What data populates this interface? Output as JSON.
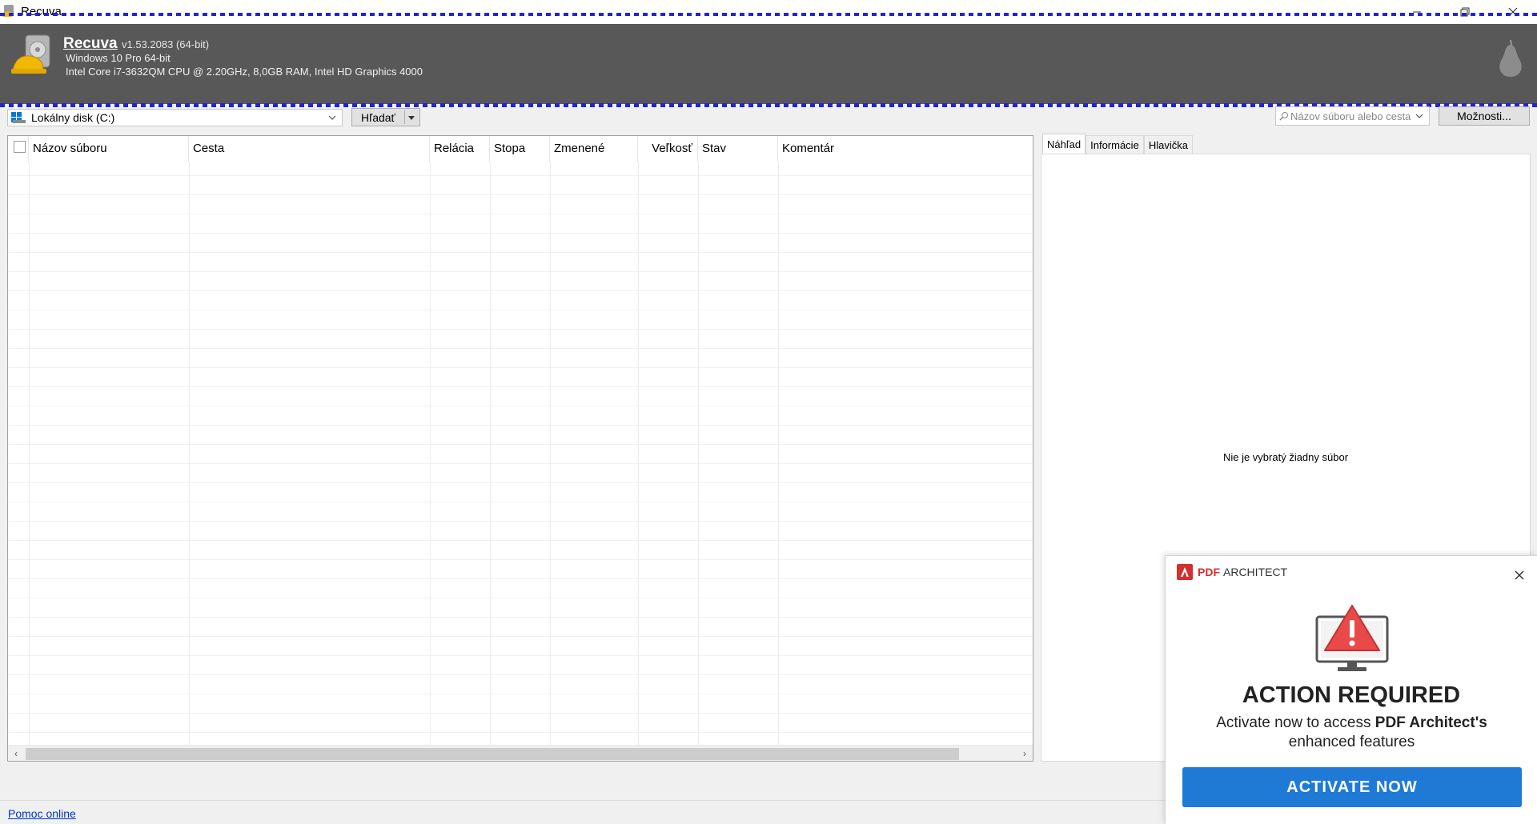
{
  "window": {
    "title": "Recuva",
    "icons": {
      "app": "recuva-app-icon",
      "minimize": "minimize-icon",
      "maximize": "restore-icon",
      "close": "close-icon"
    }
  },
  "header": {
    "app_name": "Recuva",
    "version": "v1.53.2083 (64-bit)",
    "os": "Windows 10 Pro 64-bit",
    "hardware": "Intel Core i7-3632QM CPU @ 2.20GHz, 8,0GB RAM, Intel HD Graphics 4000",
    "background_color": "#585858"
  },
  "toolbar": {
    "drive": "Lokálny disk (C:)",
    "scan_label": "Hľadať",
    "search_placeholder": "Názov súboru alebo cesta",
    "options_label": "Možnosti..."
  },
  "table": {
    "columns": [
      "Názov súboru",
      "Cesta",
      "Relácia",
      "Stopa",
      "Zmenené",
      "Veľkosť",
      "Stav",
      "Komentár"
    ],
    "rows": []
  },
  "panel": {
    "tabs": [
      "Náhľad",
      "Informácie",
      "Hlavička"
    ],
    "active_tab": "Náhľad",
    "empty_text": "Nie je vybratý žiadny súbor"
  },
  "status": {
    "help_link": "Pomoc online"
  },
  "popup": {
    "brand_pdf": "PDF",
    "brand_architect": "ARCHITECT",
    "headline": "ACTION REQUIRED",
    "sub_before": "Activate now to access ",
    "sub_bold": "PDF Architect's",
    "sub_after": " enhanced features",
    "cta": "ACTIVATE NOW",
    "cta_color": "#1f7ad6",
    "accent_color": "#d32f2f"
  }
}
